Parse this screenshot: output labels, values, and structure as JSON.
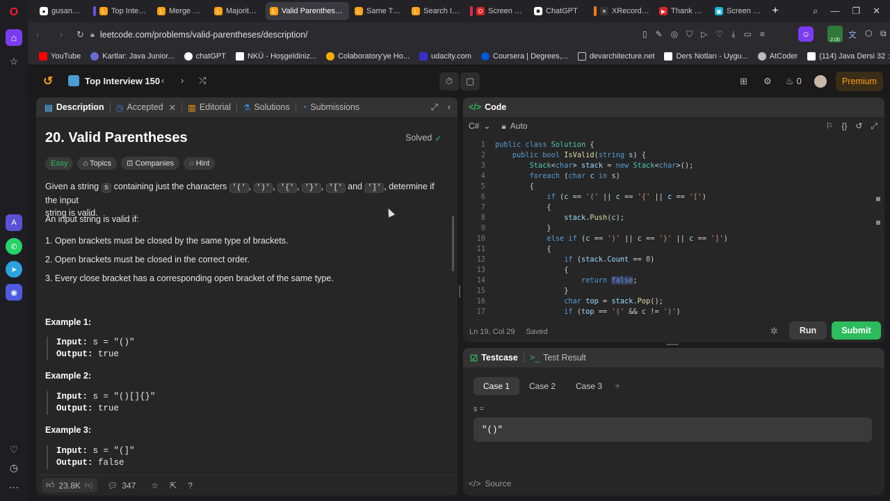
{
  "tabs": [
    {
      "label": "gusanmaz/b",
      "icon_color": "#ffffff",
      "mark": ""
    },
    {
      "label": "Top Intervie",
      "icon_color": "#ffa116",
      "mark": "#6b4ee6"
    },
    {
      "label": "Merge Two",
      "icon_color": "#ffa116",
      "mark": ""
    },
    {
      "label": "Majority Ele",
      "icon_color": "#ffa116",
      "mark": ""
    },
    {
      "label": "Valid Parentheses - Le",
      "icon_color": "#ffa116",
      "mark": ""
    },
    {
      "label": "Same Tree",
      "icon_color": "#ffa116",
      "mark": ""
    },
    {
      "label": "Search Insert",
      "icon_color": "#ffa116",
      "mark": ""
    },
    {
      "label": "Screen Reco",
      "icon_color": "#e02424",
      "mark": "#e0245e"
    },
    {
      "label": "ChatGPT",
      "icon_color": "#ffffff",
      "mark": ""
    },
    {
      "label": "XRecorder fo",
      "icon_color": "#ffffff",
      "mark": "#ff7a1a"
    },
    {
      "label": "Thank You F",
      "icon_color": "#e02424",
      "mark": ""
    },
    {
      "label": "Screen & Vi",
      "icon_color": "#1ab3d6",
      "mark": ""
    }
  ],
  "url": "leetcode.com/problems/valid-parentheses/description/",
  "badge": "2.00",
  "bookmarks": [
    {
      "label": "YouTube",
      "color": "#ff0000"
    },
    {
      "label": "Kartlar: Java Junior...",
      "color": "#6b6bd6"
    },
    {
      "label": "chatGPT",
      "color": "#ffffff"
    },
    {
      "label": "NKÜ - Hoşgeldiniz...",
      "color": "#ffffff"
    },
    {
      "label": "Colaboratory'ye Ho...",
      "color": "#f9ab00"
    },
    {
      "label": "udacity.com",
      "color": "#3b2fc9"
    },
    {
      "label": "Coursera | Degrees,...",
      "color": "#0056d2"
    },
    {
      "label": "devarchitecture.net",
      "color": "#ffffff"
    },
    {
      "label": "Ders Notları - Uygu...",
      "color": "#ffffff"
    },
    {
      "label": "AtCoder",
      "color": "#bbbbbb"
    },
    {
      "label": "(114) Java Dersi 32 :...",
      "color": "#ffffff"
    }
  ],
  "header": {
    "title": "Top Interview 150",
    "streak": "0",
    "premium": "Premium"
  },
  "left": {
    "tabs": [
      "Description",
      "Accepted",
      "Editorial",
      "Solutions",
      "Submissions"
    ],
    "problem_title": "20. Valid Parentheses",
    "solved": "Solved",
    "chips": [
      "Easy",
      "Topics",
      "Companies",
      "Hint"
    ],
    "desc_part1": "Given a string",
    "desc_s": "s",
    "desc_part2": "containing just the characters",
    "chars": [
      "'('",
      "')'",
      "'{'",
      "'}'",
      "'['",
      "']'"
    ],
    "desc_and": "and",
    "desc_part3": ", determine if the input",
    "desc_line2": "string is valid.",
    "valid_intro": "An input string is valid if:",
    "rules": [
      "1. Open brackets must be closed by the same type of brackets.",
      "2. Open brackets must be closed in the correct order.",
      "3. Every close bracket has a corresponding open bracket of the same type."
    ],
    "examples": [
      {
        "title": "Example 1:",
        "input": "s = \"()\"",
        "output": "true"
      },
      {
        "title": "Example 2:",
        "input": "s = \"()[]{}\"",
        "output": "true"
      },
      {
        "title": "Example 3:",
        "input": "s = \"(]\"",
        "output": "false"
      }
    ],
    "input_label": "Input:",
    "output_label": "Output:",
    "likes": "23.8K",
    "comments": "347"
  },
  "code": {
    "title": "Code",
    "language": "C#",
    "mode": "Auto",
    "lines": [
      "public class Solution {",
      "    public bool IsValid(string s) {",
      "        Stack<char> stack = new Stack<char>();",
      "        foreach (char c in s)",
      "        {",
      "            if (c == '(' || c == '{' || c == '[')",
      "            {",
      "                stack.Push(c);",
      "            }",
      "            else if (c == ')' || c == '}' || c == ']')",
      "            {",
      "                if (stack.Count == 0)",
      "                {",
      "                    return false;",
      "                }",
      "                char top = stack.Pop();",
      "                if (top == '(' && c != ')')"
    ],
    "status_pos": "Ln 19, Col 29",
    "status_saved": "Saved",
    "run": "Run",
    "submit": "Submit"
  },
  "test": {
    "tabs": [
      "Testcase",
      "Test Result"
    ],
    "cases": [
      "Case 1",
      "Case 2",
      "Case 3"
    ],
    "var_label": "s =",
    "value": "\"()\"",
    "source": "Source"
  }
}
